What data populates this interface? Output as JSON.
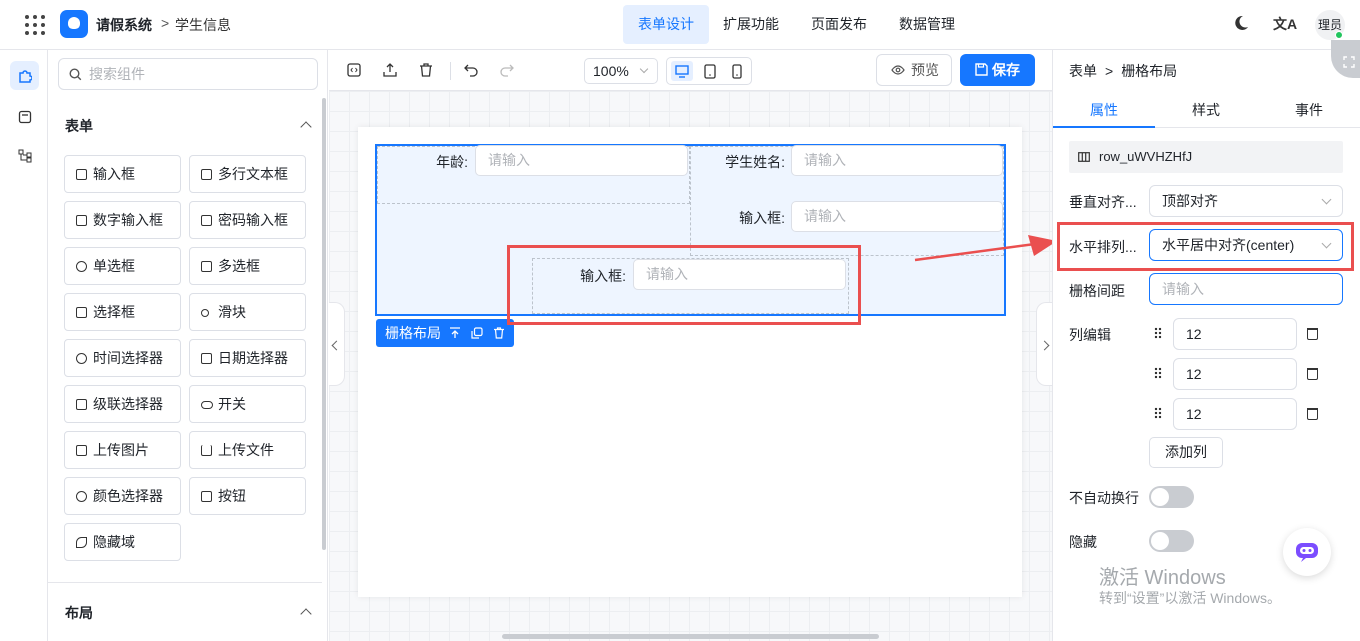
{
  "header": {
    "app_name": "请假系统",
    "breadcrumb": "学生信息",
    "nav_tabs": [
      "表单设计",
      "扩展功能",
      "页面发布",
      "数据管理"
    ],
    "user_avatar": "理员"
  },
  "components_panel": {
    "search_placeholder": "搜索组件",
    "section_form": "表单",
    "section_layout": "布局",
    "items": [
      "输入框",
      "多行文本框",
      "数字输入框",
      "密码输入框",
      "单选框",
      "多选框",
      "选择框",
      "滑块",
      "时间选择器",
      "日期选择器",
      "级联选择器",
      "开关",
      "上传图片",
      "上传文件",
      "颜色选择器",
      "按钮",
      "隐藏域"
    ]
  },
  "toolbar": {
    "zoom": "100%",
    "preview_label": "预览",
    "save_label": "保存"
  },
  "canvas": {
    "field_age_label": "年龄:",
    "field_name_label": "学生姓名:",
    "field_input_label": "输入框:",
    "field_input2_label": "输入框:",
    "input_placeholder": "请输入",
    "grid_tag_label": "栅格布局"
  },
  "props_panel": {
    "breadcrumb_root": "表单",
    "breadcrumb_current": "栅格布局",
    "tabs": [
      "属性",
      "样式",
      "事件"
    ],
    "component_id": "row_uWVHZHfJ",
    "vertical_align_label": "垂直对齐...",
    "vertical_align_value": "顶部对齐",
    "horizontal_label": "水平排列...",
    "horizontal_value": "水平居中对齐(center)",
    "gutter_label": "栅格间距",
    "gutter_placeholder": "请输入",
    "columns_label": "列编辑",
    "columns": [
      "12",
      "12",
      "12"
    ],
    "add_column_label": "添加列",
    "no_wrap_label": "不自动换行",
    "no_wrap_value": false,
    "hidden_label": "隐藏",
    "hidden_value": false
  },
  "watermark": {
    "line1": "激活 Windows",
    "line2": "转到“设置”以激活 Windows。"
  },
  "colors": {
    "accent": "#1677ff",
    "annotation_red": "#ea4f4f"
  }
}
